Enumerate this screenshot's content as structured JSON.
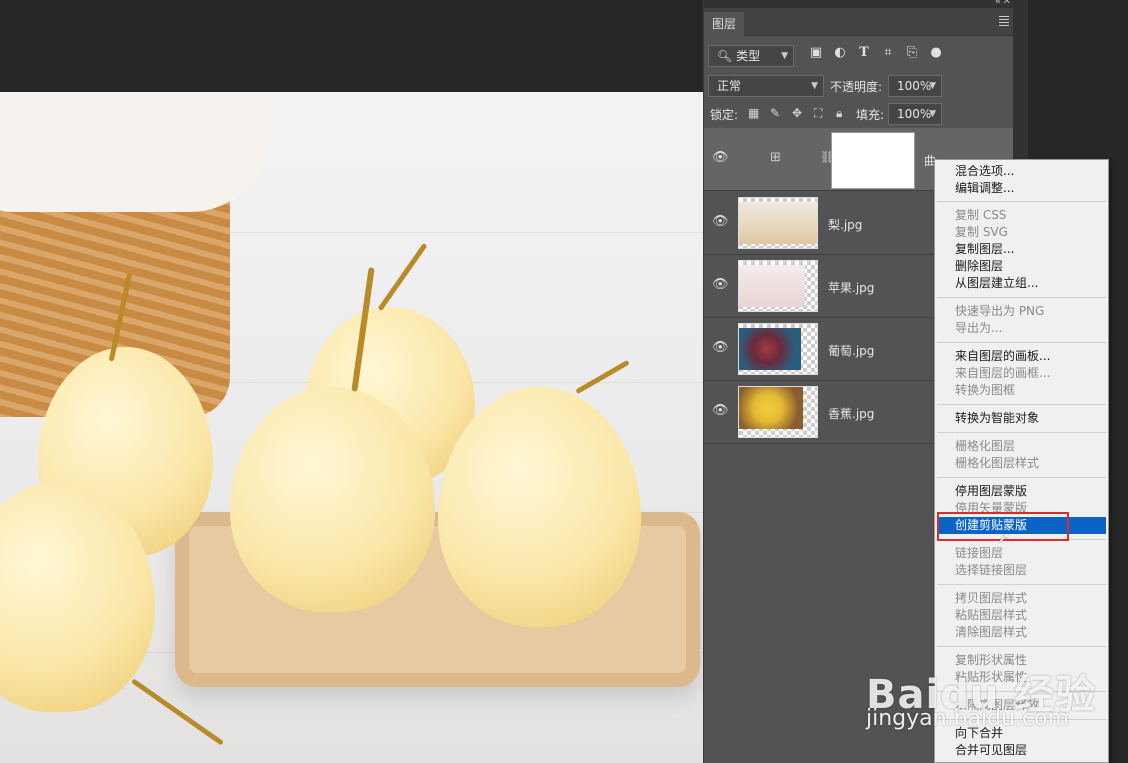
{
  "panel": {
    "tab_label": "图层",
    "filter_type": "类型",
    "blend_mode": "正常",
    "opacity_label": "不透明度:",
    "opacity_value": "100%",
    "lock_label": "锁定:",
    "fill_label": "填充:",
    "fill_value": "100%"
  },
  "layers": [
    {
      "name": "曲…",
      "kind": "adjustment"
    },
    {
      "name": "梨.jpg"
    },
    {
      "name": "苹果.jpg"
    },
    {
      "name": "葡萄.jpg"
    },
    {
      "name": "香蕉.jpg"
    }
  ],
  "context_menu": {
    "items": [
      {
        "label": "混合选项...",
        "enabled": true
      },
      {
        "label": "编辑调整...",
        "enabled": true
      },
      {
        "label": "复制 CSS",
        "enabled": false
      },
      {
        "label": "复制 SVG",
        "enabled": false
      },
      {
        "label": "复制图层...",
        "enabled": true
      },
      {
        "label": "删除图层",
        "enabled": true
      },
      {
        "label": "从图层建立组...",
        "enabled": true
      },
      {
        "label": "快速导出为 PNG",
        "enabled": false
      },
      {
        "label": "导出为...",
        "enabled": false
      },
      {
        "label": "来自图层的画板...",
        "enabled": true
      },
      {
        "label": "来自图层的画框...",
        "enabled": false
      },
      {
        "label": "转换为图框",
        "enabled": false
      },
      {
        "label": "转换为智能对象",
        "enabled": true
      },
      {
        "label": "栅格化图层",
        "enabled": false
      },
      {
        "label": "栅格化图层样式",
        "enabled": false
      },
      {
        "label": "停用图层蒙版",
        "enabled": true
      },
      {
        "label": "停用矢量蒙版",
        "enabled": false
      },
      {
        "label": "创建剪贴蒙版",
        "enabled": true,
        "highlighted": true
      },
      {
        "label": "链接图层",
        "enabled": false
      },
      {
        "label": "选择链接图层",
        "enabled": false
      },
      {
        "label": "拷贝图层样式",
        "enabled": false
      },
      {
        "label": "粘贴图层样式",
        "enabled": false
      },
      {
        "label": "清除图层样式",
        "enabled": false
      },
      {
        "label": "复制形状属性",
        "enabled": false
      },
      {
        "label": "粘贴形状属性",
        "enabled": false
      },
      {
        "label": "从隔离图层释放",
        "enabled": false
      },
      {
        "label": "向下合并",
        "enabled": true
      },
      {
        "label": "合并可见图层",
        "enabled": true
      }
    ]
  },
  "watermark": {
    "brand": "Baidu 经验",
    "sub": "jingyan.baidu.com"
  },
  "colors": {
    "highlight": "#0a64c8",
    "annotation": "#e02a2a",
    "panel_bg": "#535353"
  }
}
